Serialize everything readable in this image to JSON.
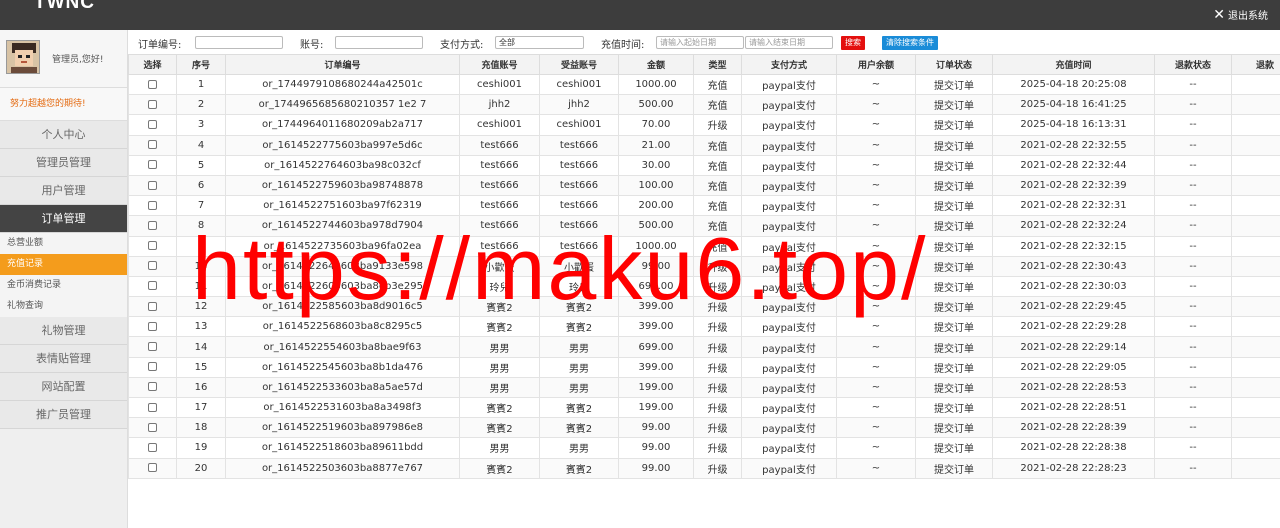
{
  "app": {
    "logo": "TWNC",
    "logout": "退出系统"
  },
  "sidebar": {
    "greeting": "管理员,您好!",
    "motto": "努力超越您的期待!",
    "items": [
      {
        "label": "个人中心",
        "active": false
      },
      {
        "label": "管理员管理",
        "active": false
      },
      {
        "label": "用户管理",
        "active": false
      },
      {
        "label": "订单管理",
        "active": true
      }
    ],
    "subitems": [
      {
        "label": "总营业额",
        "active": false
      },
      {
        "label": "充值记录",
        "active": true
      },
      {
        "label": "金币消费记录",
        "active": false
      },
      {
        "label": "礼物查询",
        "active": false
      }
    ],
    "items2": [
      {
        "label": "礼物管理"
      },
      {
        "label": "表情贴管理"
      },
      {
        "label": "网站配置"
      },
      {
        "label": "推广员管理"
      }
    ]
  },
  "search": {
    "order_no_label": "订单编号:",
    "account_label": "账号:",
    "pay_method_label": "支付方式:",
    "pay_method_value": "全部",
    "time_label": "充值时间:",
    "start_placeholder": "请输入起始日期",
    "end_placeholder": "请输入结束日期",
    "search_btn": "搜索",
    "clear_btn": "清除搜索条件"
  },
  "table": {
    "columns": [
      "选择",
      "序号",
      "订单编号",
      "充值账号",
      "受益账号",
      "金额",
      "类型",
      "支付方式",
      "用户余额",
      "订单状态",
      "充值时间",
      "退款状态",
      "退款"
    ],
    "rows": [
      [
        "1",
        "or_1744979108680244a42501c",
        "ceshi001",
        "ceshi001",
        "1000.00",
        "充值",
        "paypal支付",
        "~",
        "提交订单",
        "2025-04-18 20:25:08",
        "--"
      ],
      [
        "2",
        "or_1744965685680210357 1e2 7",
        "jhh2",
        "jhh2",
        "500.00",
        "充值",
        "paypal支付",
        "~",
        "提交订单",
        "2025-04-18 16:41:25",
        "--"
      ],
      [
        "3",
        "or_1744964011680209ab2a717",
        "ceshi001",
        "ceshi001",
        "70.00",
        "升级",
        "paypal支付",
        "~",
        "提交订单",
        "2025-04-18 16:13:31",
        "--"
      ],
      [
        "4",
        "or_1614522775603ba997e5d6c",
        "test666",
        "test666",
        "21.00",
        "充值",
        "paypal支付",
        "~",
        "提交订单",
        "2021-02-28 22:32:55",
        "--"
      ],
      [
        "5",
        "or_1614522764603ba98c032cf",
        "test666",
        "test666",
        "30.00",
        "充值",
        "paypal支付",
        "~",
        "提交订单",
        "2021-02-28 22:32:44",
        "--"
      ],
      [
        "6",
        "or_1614522759603ba98748878",
        "test666",
        "test666",
        "100.00",
        "充值",
        "paypal支付",
        "~",
        "提交订单",
        "2021-02-28 22:32:39",
        "--"
      ],
      [
        "7",
        "or_1614522751603ba97f62319",
        "test666",
        "test666",
        "200.00",
        "充值",
        "paypal支付",
        "~",
        "提交订单",
        "2021-02-28 22:32:31",
        "--"
      ],
      [
        "8",
        "or_1614522744603ba978d7904",
        "test666",
        "test666",
        "500.00",
        "充值",
        "paypal支付",
        "~",
        "提交订单",
        "2021-02-28 22:32:24",
        "--"
      ],
      [
        "9",
        "or_1614522735603ba96fa02ea",
        "test666",
        "test666",
        "1000.00",
        "充值",
        "paypal支付",
        "~",
        "提交订单",
        "2021-02-28 22:32:15",
        "--"
      ],
      [
        "10",
        "or_1614522643603ba9133e598",
        "小歡蛋",
        "小歡蛋",
        "99.00",
        "升级",
        "paypal支付",
        "~",
        "提交订单",
        "2021-02-28 22:30:43",
        "--"
      ],
      [
        "11",
        "or_1614522603603ba8eb3e295",
        "玲兒",
        "玲兒",
        "699.00",
        "升级",
        "paypal支付",
        "~",
        "提交订单",
        "2021-02-28 22:30:03",
        "--"
      ],
      [
        "12",
        "or_1614522585603ba8d9016c5",
        "賓賓2",
        "賓賓2",
        "399.00",
        "升级",
        "paypal支付",
        "~",
        "提交订单",
        "2021-02-28 22:29:45",
        "--"
      ],
      [
        "13",
        "or_1614522568603ba8c8295c5",
        "賓賓2",
        "賓賓2",
        "399.00",
        "升级",
        "paypal支付",
        "~",
        "提交订单",
        "2021-02-28 22:29:28",
        "--"
      ],
      [
        "14",
        "or_1614522554603ba8bae9f63",
        "男男",
        "男男",
        "699.00",
        "升级",
        "paypal支付",
        "~",
        "提交订单",
        "2021-02-28 22:29:14",
        "--"
      ],
      [
        "15",
        "or_1614522545603ba8b1da476",
        "男男",
        "男男",
        "399.00",
        "升级",
        "paypal支付",
        "~",
        "提交订单",
        "2021-02-28 22:29:05",
        "--"
      ],
      [
        "16",
        "or_1614522533603ba8a5ae57d",
        "男男",
        "男男",
        "199.00",
        "升级",
        "paypal支付",
        "~",
        "提交订单",
        "2021-02-28 22:28:53",
        "--"
      ],
      [
        "17",
        "or_1614522531603ba8a3498f3",
        "賓賓2",
        "賓賓2",
        "199.00",
        "升级",
        "paypal支付",
        "~",
        "提交订单",
        "2021-02-28 22:28:51",
        "--"
      ],
      [
        "18",
        "or_1614522519603ba897986e8",
        "賓賓2",
        "賓賓2",
        "99.00",
        "升级",
        "paypal支付",
        "~",
        "提交订单",
        "2021-02-28 22:28:39",
        "--"
      ],
      [
        "19",
        "or_1614522518603ba89611bdd",
        "男男",
        "男男",
        "99.00",
        "升级",
        "paypal支付",
        "~",
        "提交订单",
        "2021-02-28 22:28:38",
        "--"
      ],
      [
        "20",
        "or_1614522503603ba8877e767",
        "賓賓2",
        "賓賓2",
        "99.00",
        "升级",
        "paypal支付",
        "~",
        "提交订单",
        "2021-02-28 22:28:23",
        "--"
      ]
    ]
  },
  "watermark": "https://maku6.top/"
}
